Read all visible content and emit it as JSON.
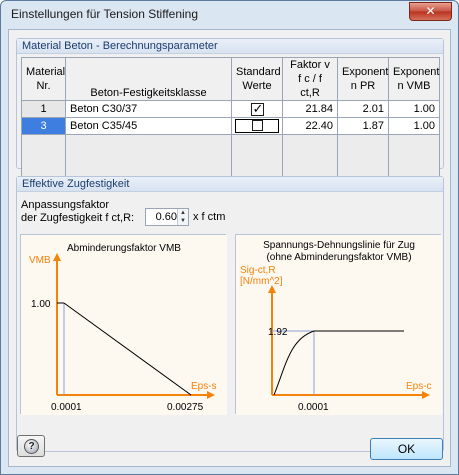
{
  "window": {
    "title": "Einstellungen für Tension Stiffening",
    "close_glyph": "✕"
  },
  "material_group": {
    "title": "Material Beton - Berechnungsparameter",
    "headers": {
      "nr_line1": "Material",
      "nr_line2": "Nr.",
      "class": "Beton-Festigkeitsklasse",
      "std_line1": "Standard",
      "std_line2": "Werte",
      "faktor_line1": "Faktor v",
      "faktor_line2": "f c / f ct,R",
      "exp_pr_line1": "Exponent",
      "exp_pr_line2": "n PR",
      "exp_vmb_line1": "Exponent",
      "exp_vmb_line2": "n VMB"
    },
    "rows": [
      {
        "nr": "1",
        "class": "Beton C30/37",
        "standard": true,
        "faktor": "21.84",
        "exp_pr": "2.01",
        "exp_vmb": "1.00",
        "selected": false
      },
      {
        "nr": "3",
        "class": "Beton C35/45",
        "standard": false,
        "faktor": "22.40",
        "exp_pr": "1.87",
        "exp_vmb": "1.00",
        "selected": true
      }
    ]
  },
  "tension_group": {
    "title": "Effektive Zugfestigkeit",
    "label_line1": "Anpassungsfaktor",
    "label_line2": "der Zugfestigkeit f ct,R:",
    "value": "0.60",
    "unit": "x f ctm"
  },
  "chart_data": [
    {
      "type": "line",
      "title": "Abminderungsfaktor VMB",
      "ylabel": "VMB",
      "xlabel": "Eps-s",
      "x_ticks": [
        "0.0001",
        "0.00275"
      ],
      "y_ticks": [
        "1.00"
      ],
      "series": [
        {
          "x": [
            0.0001,
            0.00275
          ],
          "y": [
            1.0,
            0.0
          ]
        }
      ],
      "xlim": [
        0,
        0.00275
      ],
      "ylim": [
        0,
        1.0
      ],
      "grid": false,
      "colors": {
        "axis": "#f5820a",
        "line": "#000000",
        "guide": "#8fa0d6",
        "bg": "#fdf8f0"
      }
    },
    {
      "type": "line",
      "title_line1": "Spannungs-Dehnungslinie für Zug",
      "title_line2": "(ohne Abminderungsfaktor VMB)",
      "ylabel_line1": "Sig-ct,R",
      "ylabel_line2": "[N/mm^2]",
      "xlabel": "Eps-c",
      "x_ticks": [
        "0.0001"
      ],
      "y_ticks": [
        "1.92"
      ],
      "series": [
        {
          "x": [
            0,
            0.0001,
            0.00035
          ],
          "y": [
            0,
            1.92,
            1.92
          ]
        }
      ],
      "grid": false,
      "colors": {
        "axis": "#f5820a",
        "line": "#000000",
        "guide": "#8fa0d6",
        "bg": "#fdf8f0"
      }
    }
  ],
  "buttons": {
    "ok": "OK",
    "help_glyph": "?"
  }
}
